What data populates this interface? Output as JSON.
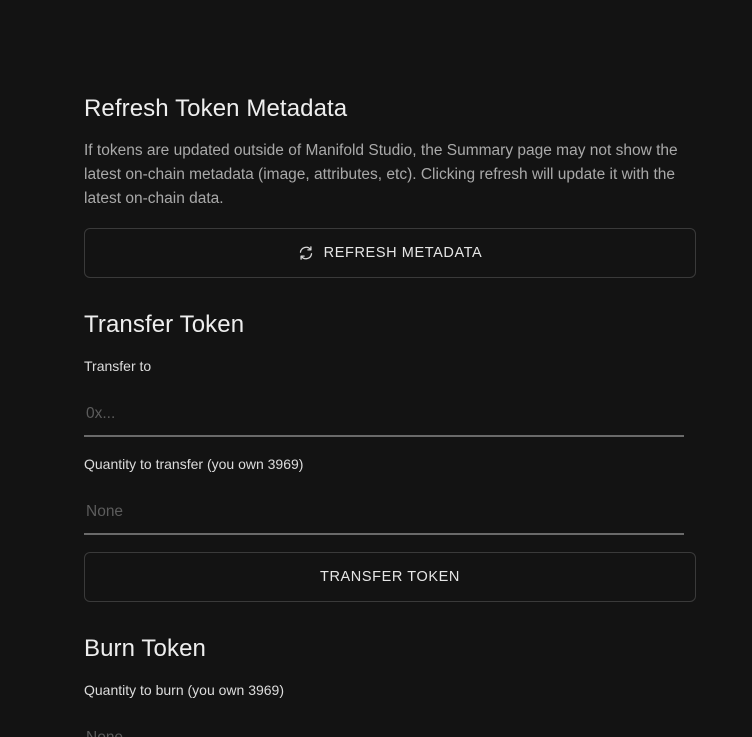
{
  "refresh": {
    "title": "Refresh Token Metadata",
    "description": "If tokens are updated outside of Manifold Studio, the Summary page may not show the latest on-chain metadata (image, attributes, etc). Clicking refresh will update it with the latest on-chain data.",
    "button_label": "REFRESH METADATA",
    "button_icon": "refresh-icon"
  },
  "transfer": {
    "title": "Transfer Token",
    "to_label": "Transfer to",
    "to_placeholder": "0x...",
    "to_value": "",
    "quantity_label": "Quantity to transfer (you own 3969)",
    "quantity_placeholder": "None",
    "quantity_value": "",
    "button_label": "TRANSFER TOKEN"
  },
  "burn": {
    "title": "Burn Token",
    "quantity_label": "Quantity to burn (you own 3969)",
    "quantity_placeholder": "None",
    "quantity_value": ""
  }
}
